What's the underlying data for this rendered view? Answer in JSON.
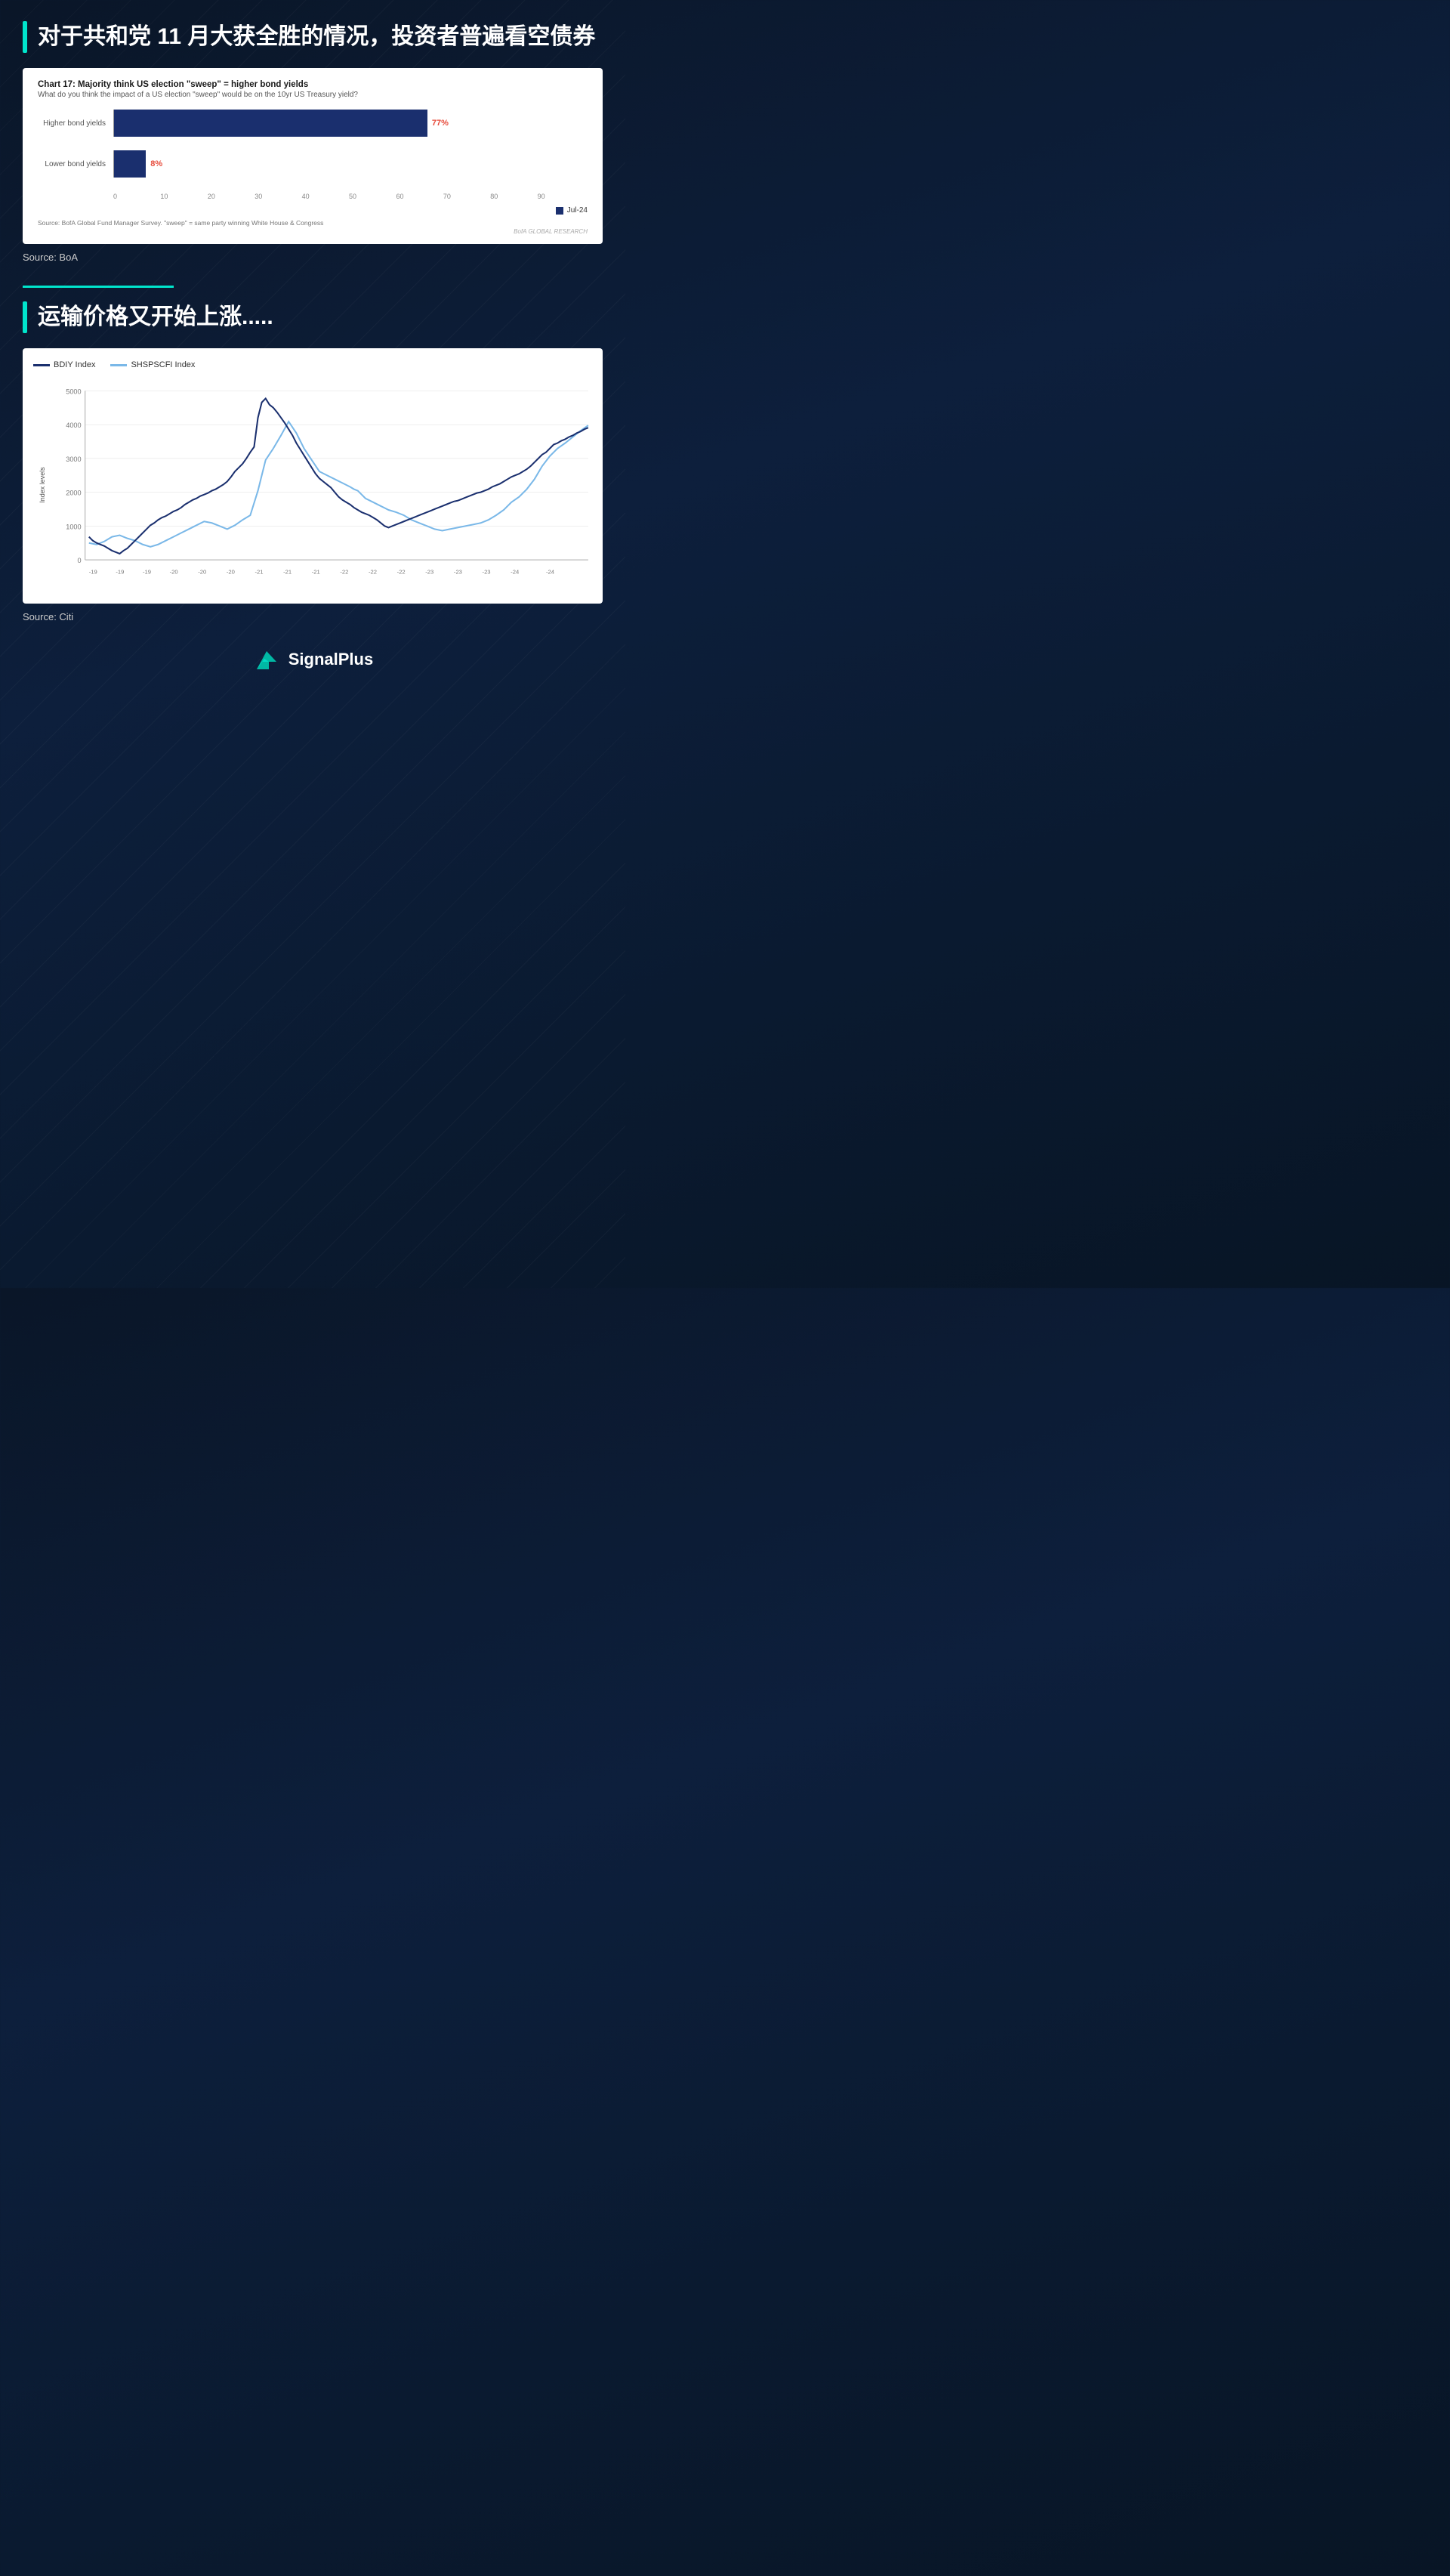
{
  "section1": {
    "title": "对于共和党 11 月大获全胜的情况，投资者普遍看空债券",
    "chart": {
      "title": "Chart 17: Majority think US election \"sweep\" = higher bond yields",
      "subtitle": "What do you think the impact of a US election \"sweep\" would be on the 10yr US Treasury yield?",
      "bars": [
        {
          "label": "Higher bond yields",
          "value": 77,
          "valueLabel": "77%",
          "maxX": 90
        },
        {
          "label": "Lower bond yields",
          "value": 8,
          "valueLabel": "8%",
          "maxX": 90
        }
      ],
      "xTicks": [
        "0",
        "10",
        "20",
        "30",
        "40",
        "50",
        "60",
        "70",
        "80",
        "90"
      ],
      "legend": "Jul-24",
      "source": "Source: BofA Global Fund Manager Survey. \"sweep\" = same party winning White House & Congress",
      "branding": "BofA GLOBAL RESEARCH"
    },
    "sourceCaption": "Source: BoA"
  },
  "section2": {
    "title": "运输价格又开始上涨.....",
    "chart": {
      "legend1": "BDIY Index",
      "legend2": "SHSPSCFI Index",
      "yLabel": "Index levels",
      "yTicks": [
        "0",
        "1000",
        "2000",
        "3000",
        "4000",
        "5000"
      ],
      "xTicks": [
        "-19",
        "-19",
        "-19",
        "-20",
        "-20",
        "-20",
        "-21",
        "-21",
        "-21",
        "-22",
        "-22",
        "-22",
        "-23",
        "-23",
        "-23",
        "-24",
        "-24"
      ]
    },
    "sourceCaption": "Source: Citi"
  },
  "footer": {
    "brand": "SignalPlus"
  }
}
